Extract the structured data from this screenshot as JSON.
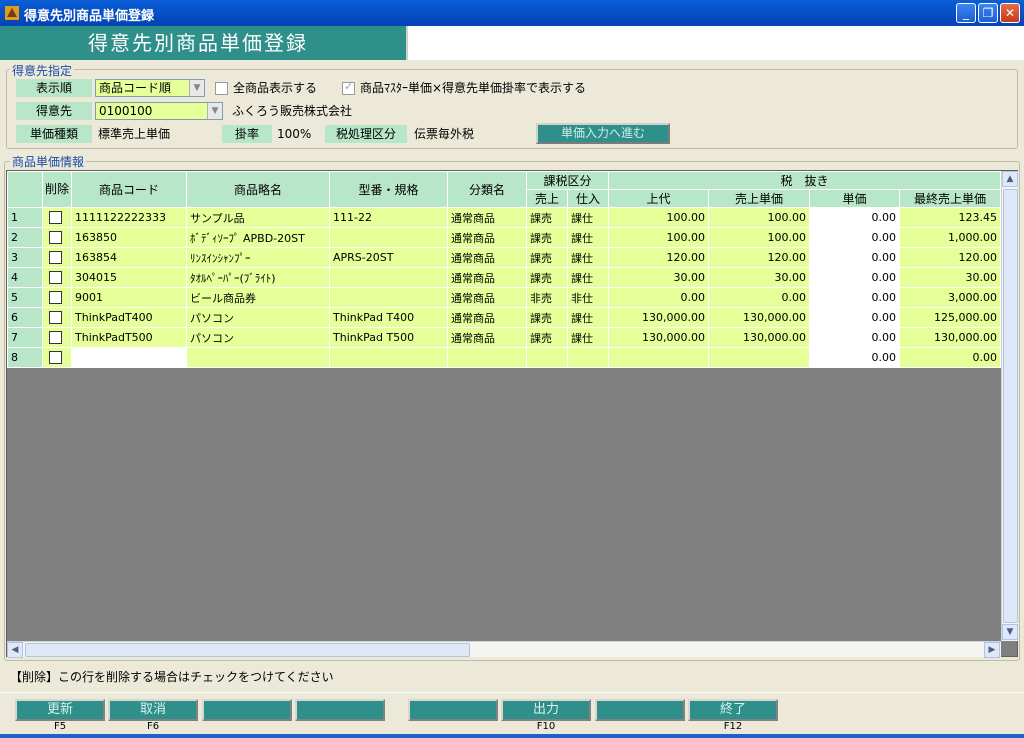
{
  "window": {
    "title": "得意先別商品単価登録"
  },
  "header": {
    "title": "得意先別商品単価登録"
  },
  "customer_group": {
    "label": "得意先指定",
    "display_order_label": "表示順",
    "display_order_value": "商品コード順",
    "show_all_label": "全商品表示する",
    "master_price_label": "商品ﾏｽﾀｰ単価×得意先単価掛率で表示する",
    "customer_label": "得意先",
    "customer_code": "0100100",
    "customer_name": "ふくろう販売株式会社",
    "price_type_label": "単価種類",
    "price_type_value": "標準売上単価",
    "rate_label": "掛率",
    "rate_value": "100%",
    "tax_label": "税処理区分",
    "tax_value": "伝票毎外税",
    "go_button": "単価入力へ進む"
  },
  "grid_group": {
    "label": "商品単価情報"
  },
  "grid": {
    "headers": {
      "delete": "削除",
      "code": "商品コード",
      "name": "商品略名",
      "model": "型番・規格",
      "category": "分類名",
      "tax_group": "課税区分",
      "tax_sale": "売上",
      "tax_purchase": "仕入",
      "tax_excluded": "税　抜き",
      "list_price": "上代",
      "sale_price": "売上単価",
      "unit_price": "単価",
      "last_price": "最終売上単価"
    },
    "rows": [
      {
        "no": "1",
        "code": "1111122222333",
        "name": "サンプル品",
        "model": "111-22",
        "category": "通常商品",
        "sale": "課売",
        "purchase": "課仕",
        "list": "100.00",
        "salep": "100.00",
        "unit": "0.00",
        "last": "123.45"
      },
      {
        "no": "2",
        "code": "163850",
        "name": "ﾎﾞﾃﾞｨｿｰﾌﾟ APBD-20ST",
        "model": "",
        "category": "通常商品",
        "sale": "課売",
        "purchase": "課仕",
        "list": "100.00",
        "salep": "100.00",
        "unit": "0.00",
        "last": "1,000.00"
      },
      {
        "no": "3",
        "code": "163854",
        "name": "ﾘﾝｽｲﾝｼｬﾝﾌﾟｰ",
        "model": "APRS-20ST",
        "category": "通常商品",
        "sale": "課売",
        "purchase": "課仕",
        "list": "120.00",
        "salep": "120.00",
        "unit": "0.00",
        "last": "120.00"
      },
      {
        "no": "4",
        "code": "304015",
        "name": "ﾀｵﾙﾍﾟｰﾊﾟｰ(ﾌﾞﾗｲﾄ)",
        "model": "",
        "category": "通常商品",
        "sale": "課売",
        "purchase": "課仕",
        "list": "30.00",
        "salep": "30.00",
        "unit": "0.00",
        "last": "30.00"
      },
      {
        "no": "5",
        "code": "9001",
        "name": "ビール商品券",
        "model": "",
        "category": "通常商品",
        "sale": "非売",
        "purchase": "非仕",
        "list": "0.00",
        "salep": "0.00",
        "unit": "0.00",
        "last": "3,000.00"
      },
      {
        "no": "6",
        "code": "ThinkPadT400",
        "name": "パソコン",
        "model": "ThinkPad T400",
        "category": "通常商品",
        "sale": "課売",
        "purchase": "課仕",
        "list": "130,000.00",
        "salep": "130,000.00",
        "unit": "0.00",
        "last": "125,000.00"
      },
      {
        "no": "7",
        "code": "ThinkPadT500",
        "name": "パソコン",
        "model": "ThinkPad T500",
        "category": "通常商品",
        "sale": "課売",
        "purchase": "課仕",
        "list": "130,000.00",
        "salep": "130,000.00",
        "unit": "0.00",
        "last": "130,000.00"
      },
      {
        "no": "8",
        "code": "",
        "name": "",
        "model": "",
        "category": "",
        "sale": "",
        "purchase": "",
        "list": "",
        "salep": "",
        "unit": "0.00",
        "last": "0.00"
      }
    ]
  },
  "note": "【削除】この行を削除する場合はチェックをつけてください",
  "fkeys": [
    {
      "label": "更新",
      "key": "F5"
    },
    {
      "label": "取消",
      "key": "F6"
    },
    {
      "label": "",
      "key": ""
    },
    {
      "label": "",
      "key": ""
    },
    {
      "label": "",
      "key": ""
    },
    {
      "label": "出力",
      "key": "F10"
    },
    {
      "label": "",
      "key": ""
    },
    {
      "label": "終了",
      "key": "F12"
    }
  ]
}
